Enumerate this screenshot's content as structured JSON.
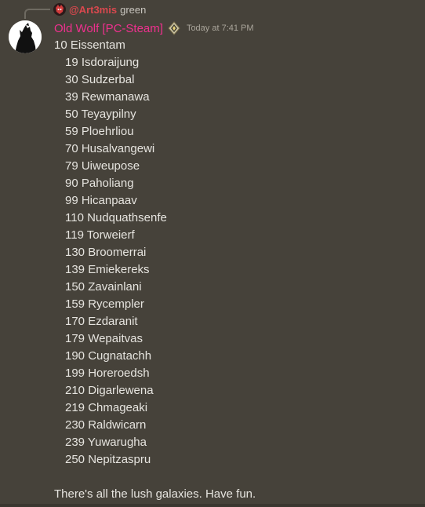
{
  "reply": {
    "author": "@Art3mis",
    "text": "green"
  },
  "message": {
    "author": "Old Wolf [PC-Steam]",
    "timestamp": "Today at 7:41 PM",
    "first_line": "10 Eissentam",
    "galaxies": [
      "19 Isdoraijung",
      "30 Sudzerbal",
      "39 Rewmanawa",
      "50 Teyaypilny",
      "59 Ploehrliou",
      "70 Husalvangewi",
      "79 Uiweupose",
      "90 Paholiang",
      "99 Hicanpaav",
      "110 Nudquathsenfe",
      "119 Torweierf",
      "130 Broomerrai",
      "139 Emiekereks",
      "150 Zavainlani",
      "159 Rycempler",
      "170 Ezdaranit",
      "179 Wepaitvas",
      "190 Cugnatachh",
      "199 Horeroedsh",
      "210 Digarlewena",
      "219 Chmageaki",
      "230 Raldwicarn",
      "239 Yuwarugha",
      "250 Nepitzaspru"
    ],
    "closing": "There's all the lush galaxies. Have fun."
  },
  "colors": {
    "background": "#46423a",
    "author": "#f0308f",
    "reply_author": "#d9484e",
    "text": "#e6e4df",
    "timestamp": "#aaa59b"
  },
  "icons": {
    "avatar": "wolf-howling-avatar",
    "reply_avatar": "red-character-avatar",
    "role": "rank-badge-icon"
  }
}
